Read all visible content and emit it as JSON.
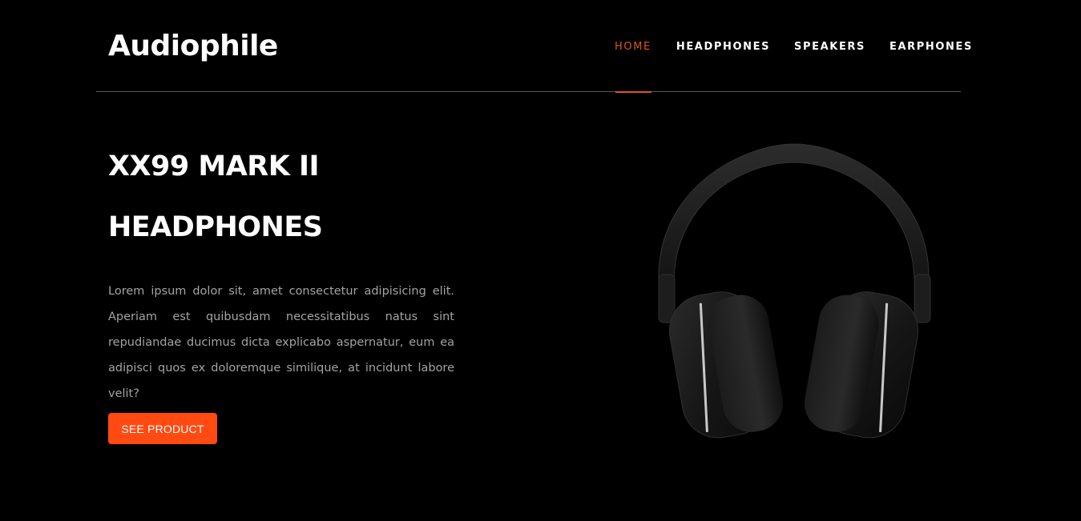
{
  "brand": {
    "name": "Audiophile"
  },
  "nav": {
    "items": [
      {
        "label": "HOME",
        "active": true
      },
      {
        "label": "HEADPHONES",
        "active": false
      },
      {
        "label": "SPEAKERS",
        "active": false
      },
      {
        "label": "EARPHONES",
        "active": false
      }
    ]
  },
  "hero": {
    "title_line1": "XX99 MARK II",
    "title_line2": "HEADPHONES",
    "description": "Lorem ipsum dolor sit, amet consectetur adipisicing elit. Aperiam est quibusdam necessitatibus natus sint repudiandae ducimus dicta explicabo aspernatur, eum ea adipisci quos ex doloremque similique, at incidunt labore velit?",
    "cta_label": "SEE PRODUCT",
    "image_icon": "headphones-icon"
  },
  "colors": {
    "background": "#000000",
    "accent": "#ff4a12",
    "nav_active": "#d8571c",
    "body_text": "#a3a3a3",
    "divider": "#5a5a5a"
  }
}
